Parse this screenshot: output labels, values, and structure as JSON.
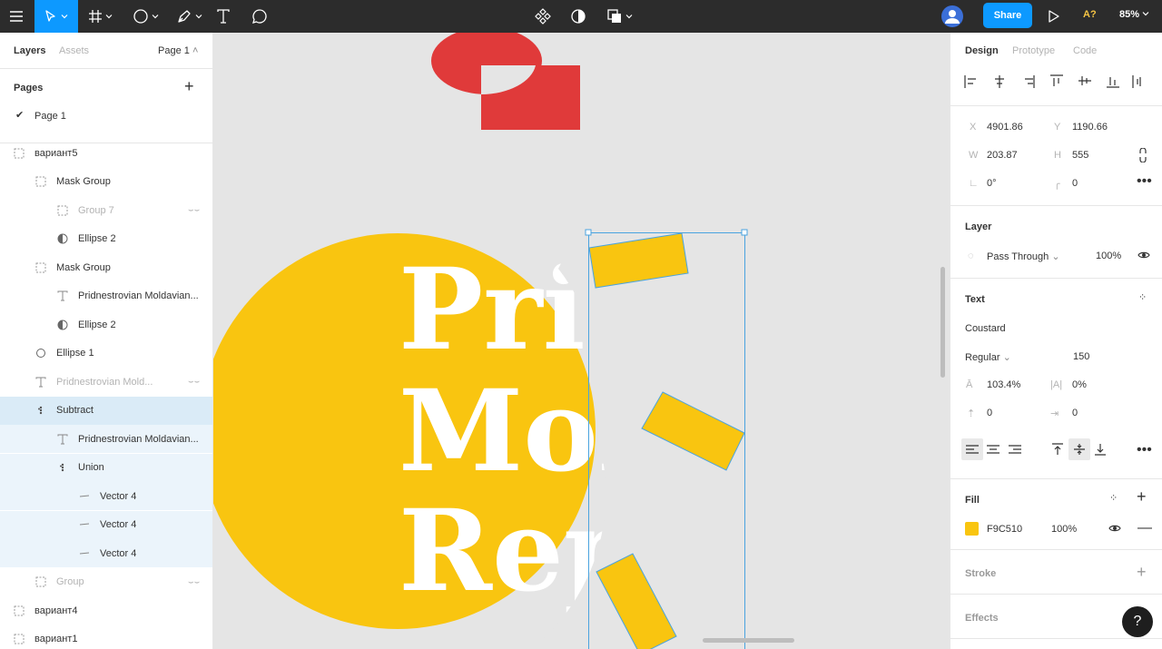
{
  "toolbar": {
    "share_label": "Share",
    "a_badge": "A?",
    "zoom": "85%"
  },
  "left_panel": {
    "tabs": [
      "Layers",
      "Assets"
    ],
    "page_selector": "Page 1",
    "pages_title": "Pages",
    "pages": [
      "Page 1"
    ],
    "layers": [
      {
        "name": "вариант5",
        "icon": "frame-icon",
        "indent": 0,
        "state": "normal"
      },
      {
        "name": "Mask Group",
        "icon": "frame-icon",
        "indent": 1,
        "state": "normal"
      },
      {
        "name": "Group 7",
        "icon": "frame-icon",
        "indent": 2,
        "state": "hidden"
      },
      {
        "name": "Ellipse 2",
        "icon": "mask-icon",
        "indent": 2,
        "state": "normal"
      },
      {
        "name": "Mask Group",
        "icon": "frame-icon",
        "indent": 1,
        "state": "normal"
      },
      {
        "name": "Pridnestrovian Moldavian...",
        "icon": "text-icon",
        "indent": 2,
        "state": "normal"
      },
      {
        "name": "Ellipse 2",
        "icon": "mask-icon",
        "indent": 2,
        "state": "normal"
      },
      {
        "name": "Ellipse 1",
        "icon": "ellipse-icon",
        "indent": 1,
        "state": "normal"
      },
      {
        "name": "Pridnestrovian Mold...",
        "icon": "text-icon",
        "indent": 1,
        "state": "hidden"
      },
      {
        "name": "Subtract",
        "icon": "boolean-icon",
        "indent": 1,
        "state": "selected"
      },
      {
        "name": "Pridnestrovian Moldavian...",
        "icon": "text-icon",
        "indent": 2,
        "state": "child"
      },
      {
        "name": "Union",
        "icon": "boolean-icon",
        "indent": 2,
        "state": "child"
      },
      {
        "name": "Vector 4",
        "icon": "vector-icon",
        "indent": 3,
        "state": "child"
      },
      {
        "name": "Vector 4",
        "icon": "vector-icon",
        "indent": 3,
        "state": "child"
      },
      {
        "name": "Vector 4",
        "icon": "vector-icon",
        "indent": 3,
        "state": "child"
      },
      {
        "name": "Group",
        "icon": "frame-icon",
        "indent": 1,
        "state": "hidden"
      },
      {
        "name": "вариант4",
        "icon": "frame-icon",
        "indent": 0,
        "state": "normal"
      },
      {
        "name": "вариант1",
        "icon": "frame-icon",
        "indent": 0,
        "state": "normal"
      }
    ]
  },
  "canvas": {
    "text_lines": [
      "Pri",
      "Mol",
      "Rep"
    ],
    "colors": {
      "yellow": "#F9C510",
      "red": "#E03A3A",
      "selection": "#4aa3df"
    }
  },
  "right_panel": {
    "tabs": [
      "Design",
      "Prototype",
      "Code"
    ],
    "x_label": "X",
    "x": "4901.86",
    "y_label": "Y",
    "y": "1190.66",
    "w_label": "W",
    "w": "203.87",
    "h_label": "H",
    "h": "555",
    "rotation": "0°",
    "radius": "0",
    "layer_title": "Layer",
    "blend_mode": "Pass Through",
    "opacity": "100%",
    "text_title": "Text",
    "font_family": "Coustard",
    "font_style": "Regular",
    "font_size": "150",
    "line_height": "103.4%",
    "letter_spacing": "0%",
    "paragraph_spacing": "0",
    "paragraph_indent": "0",
    "fill_title": "Fill",
    "fill_hex": "F9C510",
    "fill_opacity": "100%",
    "fill_color": "#F9C510",
    "stroke_title": "Stroke",
    "effects_title": "Effects",
    "help": "?"
  }
}
